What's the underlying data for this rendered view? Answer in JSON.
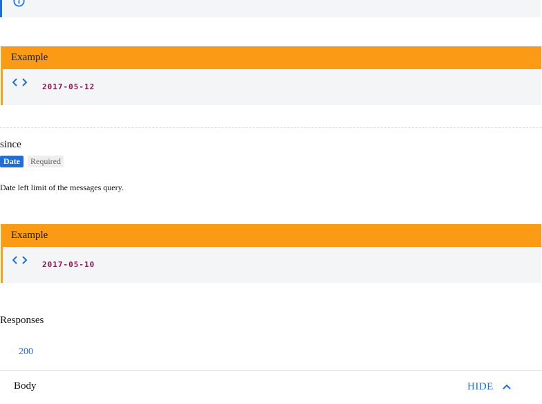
{
  "info_bar": {
    "text": "",
    "icon": "info-icon",
    "accent": "#1e6fd9"
  },
  "examples": [
    {
      "title": "Example",
      "value": "2017-05-12",
      "icon": "code-icon"
    },
    {
      "title": "Example",
      "value": "2017-05-10",
      "icon": "code-icon"
    }
  ],
  "parameter": {
    "name": "since",
    "type_badge": "Date",
    "required_badge": "Required",
    "description": "Date left limit of the messages query."
  },
  "responses": {
    "title": "Responses",
    "tabs": [
      {
        "label": "200"
      }
    ],
    "body_label": "Body",
    "toggle_label": "HIDE",
    "toggle_icon": "chevron-up-icon"
  },
  "colors": {
    "accent_blue": "#1e6fd9",
    "example_orange": "#fb9b15",
    "code_text": "#8a1455"
  }
}
